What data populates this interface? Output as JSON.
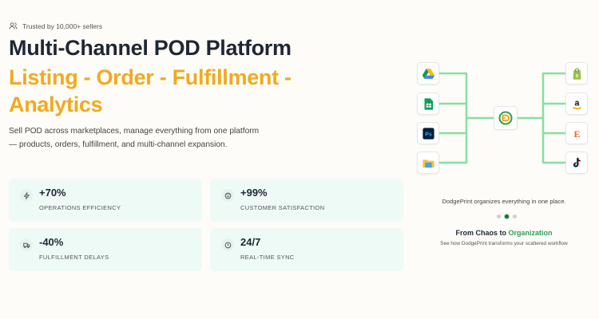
{
  "hero": {
    "trusted_text": "Trusted by 10,000+ sellers",
    "title_line1": "Multi-Channel POD Platform",
    "title_line2": "Listing - Order - Fulfillment - Analytics",
    "description": "Sell POD across marketplaces, manage everything from one platform — products, orders, fulfillment, and multi-channel expansion."
  },
  "stats": [
    {
      "value": "+70%",
      "label": "Operations efficiency",
      "icon": "lightning-icon"
    },
    {
      "value": "+99%",
      "label": "Customer satisfaction",
      "icon": "smiley-icon"
    },
    {
      "value": "-40%",
      "label": "Fulfillment delays",
      "icon": "truck-icon"
    },
    {
      "value": "24/7",
      "label": "Real-time sync",
      "icon": "clock-icon"
    }
  ],
  "diagram": {
    "sources": [
      "google-drive-icon",
      "google-sheets-icon",
      "photoshop-icon",
      "folder-icon"
    ],
    "hub": "dodgeprint-logo-icon",
    "channels": [
      "shopify-icon",
      "amazon-icon",
      "etsy-icon",
      "tiktok-icon"
    ],
    "photoshop_label": "Ps",
    "amazon_label": "a",
    "etsy_label": "E"
  },
  "showcase": {
    "caption": "DodgePrint organizes everything in one place.",
    "headline_prefix": "From Chaos to",
    "headline_highlight": "Organization",
    "subtext": "See how DodgePrint transforms your scattered workflow",
    "active_slide": 2,
    "slide_count": 3
  },
  "colors": {
    "accent_orange": "#f3a91e",
    "accent_green": "#2e9f5a",
    "connector_green": "#86e0a0",
    "stat_card_bg": "#eefaf6"
  }
}
